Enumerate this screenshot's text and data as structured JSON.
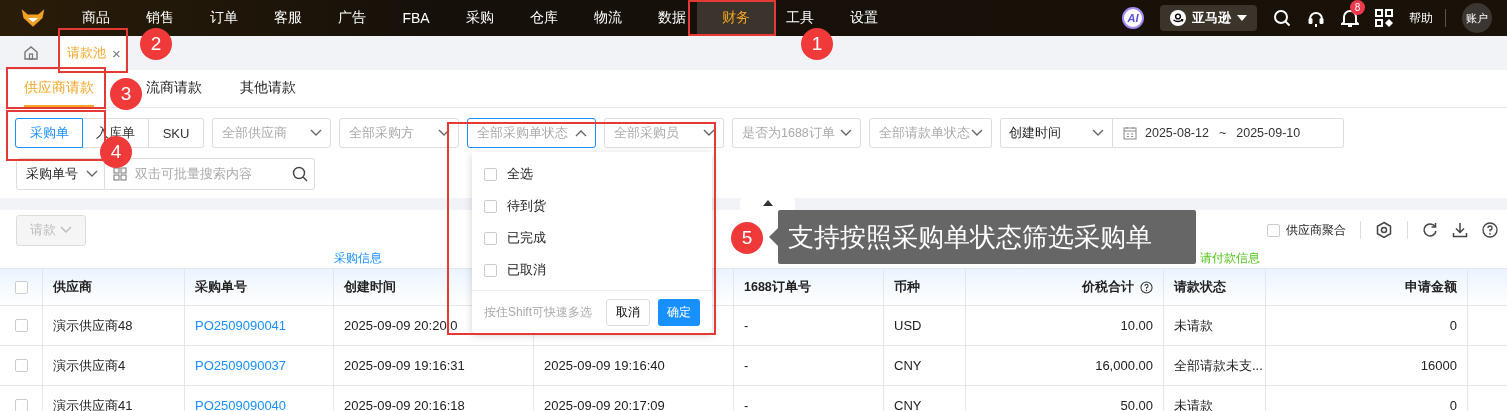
{
  "top_nav": {
    "items": [
      {
        "label": "商品",
        "selected": false
      },
      {
        "label": "销售",
        "selected": false
      },
      {
        "label": "订单",
        "selected": false
      },
      {
        "label": "客服",
        "selected": false
      },
      {
        "label": "广告",
        "selected": false
      },
      {
        "label": "FBA",
        "selected": false
      },
      {
        "label": "采购",
        "selected": false
      },
      {
        "label": "仓库",
        "selected": false
      },
      {
        "label": "物流",
        "selected": false
      },
      {
        "label": "数据",
        "selected": false
      },
      {
        "label": "财务",
        "selected": true
      },
      {
        "label": "工具",
        "selected": false
      },
      {
        "label": "设置",
        "selected": false
      }
    ],
    "ai_badge": "AI",
    "marketplace": "亚马逊",
    "notification_count": "8",
    "help": "帮助",
    "account": "账户"
  },
  "page_tabs": [
    {
      "label": "请款池",
      "selected": true,
      "close": "×"
    }
  ],
  "sub_tabs": [
    {
      "label": "供应商请款",
      "selected": true
    },
    {
      "label": "流商请款",
      "selected": false
    },
    {
      "label": "其他请款",
      "selected": false
    }
  ],
  "filters": {
    "doc_type": [
      {
        "label": "采购单",
        "selected": true
      },
      {
        "label": "入库单",
        "selected": false
      },
      {
        "label": "SKU",
        "selected": false
      }
    ],
    "selects": [
      {
        "placeholder": "全部供应商",
        "expanded": false
      },
      {
        "placeholder": "全部采购方",
        "expanded": false
      },
      {
        "placeholder": "全部采购单状态",
        "expanded": true
      },
      {
        "placeholder": "全部采购员",
        "expanded": false
      },
      {
        "placeholder": "是否为1688订单",
        "expanded": false
      },
      {
        "placeholder": "全部请款单状态",
        "expanded": false
      }
    ],
    "date_field": {
      "type": "创建时间",
      "start": "2025-08-12",
      "separator": "~",
      "end": "2025-09-10"
    },
    "search_type": "采购单号",
    "search": {
      "placeholder": "双击可批量搜索内容"
    }
  },
  "status_dropdown": {
    "options": [
      {
        "label": "全选",
        "checked": false
      },
      {
        "label": "待到货",
        "checked": false
      },
      {
        "label": "已完成",
        "checked": false
      },
      {
        "label": "已取消",
        "checked": false
      }
    ],
    "hint": "按住Shift可快速多选",
    "cancel": "取消",
    "confirm": "确定"
  },
  "toolbar": {
    "request_button": {
      "label": "请款",
      "disabled": true
    },
    "aggregate": {
      "label": "供应商聚合",
      "checked": false
    }
  },
  "tooltip": {
    "marker": "5",
    "text": "支持按照采购单状态筛选采购单"
  },
  "annotations": [
    {
      "marker": "1"
    },
    {
      "marker": "2"
    },
    {
      "marker": "3"
    },
    {
      "marker": "4"
    }
  ],
  "table": {
    "groups": [
      {
        "label": "采购信息",
        "kind": "purchase"
      },
      {
        "label": "请付款信息",
        "kind": "payment"
      }
    ],
    "all_selected": false,
    "columns": [
      {
        "label": "供应商"
      },
      {
        "label": "采购单号"
      },
      {
        "label": "创建时间"
      },
      {},
      {
        "label": "1688订单号"
      },
      {
        "label": "币种"
      },
      {
        "label": "价税合计",
        "help": true
      },
      {
        "label": "请款状态"
      },
      {
        "label": "申请金额"
      },
      {}
    ],
    "rows": [
      {
        "selected": false,
        "cells": [
          "演示供应商48",
          "PO2509090041",
          "2025-09-09 20:20:0",
          null,
          "-",
          "USD",
          "10.00",
          "未请款",
          "0",
          null
        ]
      },
      {
        "selected": false,
        "cells": [
          "演示供应商4",
          "PO2509090037",
          "2025-09-09 19:16:31",
          "2025-09-09 19:16:40",
          "-",
          "CNY",
          "16,000.00",
          "全部请款未支...",
          "16000",
          null
        ]
      },
      {
        "selected": false,
        "cells": [
          "演示供应商41",
          "PO2509090040",
          "2025-09-09 20:16:18",
          "2025-09-09 20:17:09",
          "-",
          "CNY",
          "50.00",
          "未请款",
          "0",
          null
        ]
      }
    ]
  }
}
